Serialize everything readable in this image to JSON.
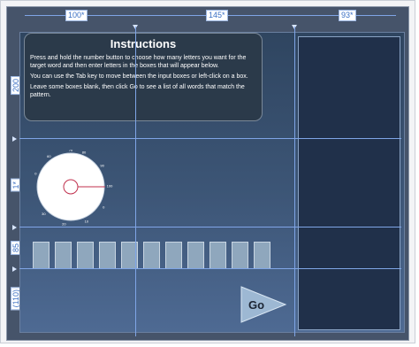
{
  "rulers": {
    "columns": [
      "100*",
      "145*",
      "93*"
    ],
    "rows": [
      "200",
      "1*",
      "85",
      "(110)"
    ]
  },
  "instructions": {
    "title": "Instructions",
    "paragraphs": [
      "Press and hold the number button to choose how many letters you want for the target word and then enter letters in the boxes that will appear below.",
      "You can use the Tab key to move between the input boxes or left-click on a box.",
      "Leave some boxes blank, then click Go to see a list of all  words that match the pattern."
    ]
  },
  "dial": {
    "tick_labels": [
      "80",
      "90",
      "100",
      "0",
      "10",
      "20",
      "30",
      "40",
      "50",
      "60",
      "70"
    ]
  },
  "letter_boxes": {
    "count": 11
  },
  "go_button": {
    "label": "Go"
  },
  "colors": {
    "guide": "#7fa5e6",
    "panel": "#20304a",
    "box": "#8fa7bd"
  }
}
